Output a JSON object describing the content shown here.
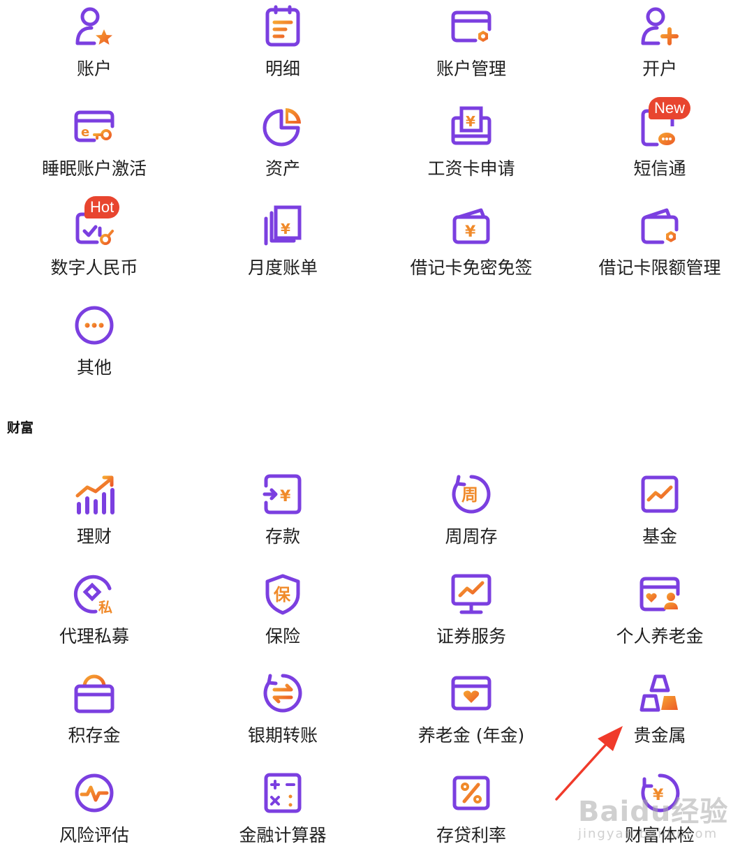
{
  "account_section": {
    "items": [
      {
        "label": "账户",
        "icon": "user-star-icon"
      },
      {
        "label": "明细",
        "icon": "document-list-icon"
      },
      {
        "label": "账户管理",
        "icon": "card-gear-icon"
      },
      {
        "label": "开户",
        "icon": "user-add-icon"
      },
      {
        "label": "睡眠账户激活",
        "icon": "card-key-icon"
      },
      {
        "label": "资产",
        "icon": "pie-chart-icon"
      },
      {
        "label": "工资卡申请",
        "icon": "salary-card-icon"
      },
      {
        "label": "短信通",
        "icon": "sms-phone-icon",
        "badge": "New"
      },
      {
        "label": "数字人民币",
        "icon": "digital-rmb-icon",
        "badge": "Hot"
      },
      {
        "label": "月度账单",
        "icon": "monthly-bill-icon"
      },
      {
        "label": "借记卡免密免签",
        "icon": "debit-card-wallet-icon"
      },
      {
        "label": "借记卡限额管理",
        "icon": "debit-card-limit-icon"
      },
      {
        "label": "其他",
        "icon": "more-icon"
      }
    ]
  },
  "wealth_section": {
    "title": "财富",
    "items": [
      {
        "label": "理财",
        "icon": "growth-chart-icon"
      },
      {
        "label": "存款",
        "icon": "deposit-icon"
      },
      {
        "label": "周周存",
        "icon": "weekly-deposit-icon",
        "glyph": "周"
      },
      {
        "label": "基金",
        "icon": "fund-chart-icon"
      },
      {
        "label": "代理私募",
        "icon": "private-fund-icon",
        "glyph": "私"
      },
      {
        "label": "保险",
        "icon": "insurance-shield-icon",
        "glyph": "保"
      },
      {
        "label": "证券服务",
        "icon": "securities-monitor-icon"
      },
      {
        "label": "个人养老金",
        "icon": "pension-card-icon"
      },
      {
        "label": "积存金",
        "icon": "gold-savings-bag-icon"
      },
      {
        "label": "银期转账",
        "icon": "bank-futures-transfer-icon"
      },
      {
        "label": "养老金 (年金)",
        "icon": "annuity-card-icon"
      },
      {
        "label": "贵金属",
        "icon": "precious-metal-icon"
      },
      {
        "label": "风险评估",
        "icon": "risk-assessment-icon"
      },
      {
        "label": "金融计算器",
        "icon": "calculator-icon"
      },
      {
        "label": "存贷利率",
        "icon": "interest-rate-icon"
      },
      {
        "label": "财富体检",
        "icon": "wealth-checkup-icon"
      }
    ]
  },
  "watermark": {
    "main": "Baidu经验",
    "sub": "jingyan.baidu.com"
  },
  "colors": {
    "purple": "#7b3fe0",
    "orange": "#f08a2a",
    "badge_red": "#e8452f",
    "arrow_red": "#f03a2a"
  }
}
